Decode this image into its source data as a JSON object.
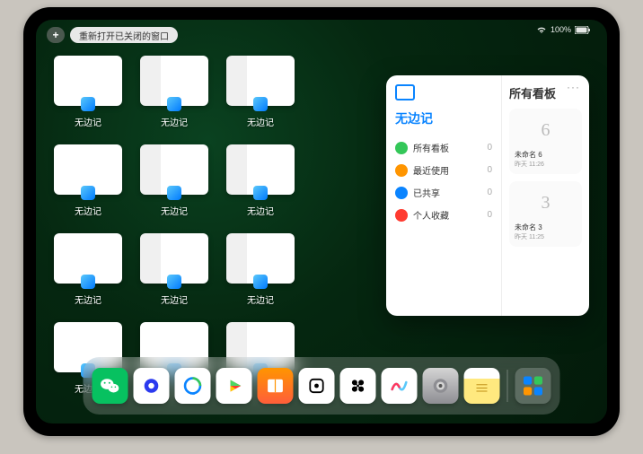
{
  "status": {
    "battery": "100%"
  },
  "toolbar": {
    "plus_label": "+",
    "reopen_label": "重新打开已关闭的窗口"
  },
  "grid": {
    "app_label": "无边记",
    "cards": [
      {
        "style": "blank"
      },
      {
        "style": "detail"
      },
      {
        "style": "detail"
      },
      {
        "style": "blank"
      },
      {
        "style": "detail"
      },
      {
        "style": "detail"
      },
      {
        "style": "blank"
      },
      {
        "style": "detail"
      },
      {
        "style": "detail"
      },
      {
        "style": "blank"
      },
      {
        "style": "blank"
      },
      {
        "style": "detail"
      }
    ]
  },
  "popup": {
    "more": "···",
    "left_title": "无边记",
    "right_title": "所有看板",
    "items": [
      {
        "icon_color": "#34c759",
        "label": "所有看板",
        "count": "0"
      },
      {
        "icon_color": "#ff9500",
        "label": "最近使用",
        "count": "0"
      },
      {
        "icon_color": "#0a84ff",
        "label": "已共享",
        "count": "0"
      },
      {
        "icon_color": "#ff3b30",
        "label": "个人收藏",
        "count": "0"
      }
    ],
    "boards": [
      {
        "sketch": "6",
        "name": "未命名 6",
        "time": "昨天 11:26"
      },
      {
        "sketch": "3",
        "name": "未命名 3",
        "time": "昨天 11:25"
      }
    ]
  },
  "dock": {
    "icons": [
      {
        "name": "wechat-icon",
        "cls": "di-wechat"
      },
      {
        "name": "quark-icon",
        "cls": "di-quark"
      },
      {
        "name": "browser-icon",
        "cls": "di-browser"
      },
      {
        "name": "play-icon",
        "cls": "di-play"
      },
      {
        "name": "books-icon",
        "cls": "di-books"
      },
      {
        "name": "dice-icon",
        "cls": "di-dice"
      },
      {
        "name": "link-icon",
        "cls": "di-link"
      },
      {
        "name": "freeform-icon",
        "cls": "di-freeform"
      },
      {
        "name": "settings-icon",
        "cls": "di-settings"
      },
      {
        "name": "notes-icon",
        "cls": "di-notes"
      }
    ],
    "recent": [
      {
        "name": "app-library-icon",
        "cls": "di-folder"
      }
    ]
  }
}
